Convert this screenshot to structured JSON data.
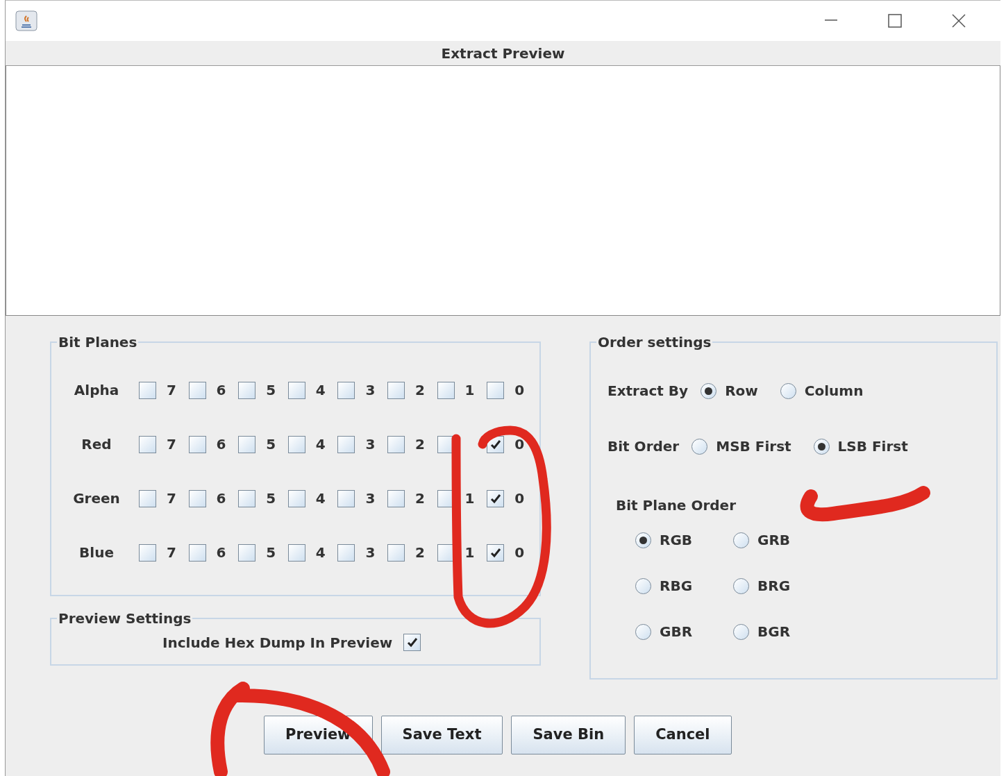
{
  "window": {
    "title": "Extract Preview"
  },
  "bit_planes": {
    "title": "Bit Planes",
    "rows": [
      {
        "label": "Alpha",
        "bits": [
          {
            "label": "7",
            "checked": false
          },
          {
            "label": "6",
            "checked": false
          },
          {
            "label": "5",
            "checked": false
          },
          {
            "label": "4",
            "checked": false
          },
          {
            "label": "3",
            "checked": false
          },
          {
            "label": "2",
            "checked": false
          },
          {
            "label": "1",
            "checked": false
          },
          {
            "label": "0",
            "checked": false
          }
        ]
      },
      {
        "label": "Red",
        "bits": [
          {
            "label": "7",
            "checked": false
          },
          {
            "label": "6",
            "checked": false
          },
          {
            "label": "5",
            "checked": false
          },
          {
            "label": "4",
            "checked": false
          },
          {
            "label": "3",
            "checked": false
          },
          {
            "label": "2",
            "checked": false
          },
          {
            "checked": false
          },
          {
            "label": "0",
            "checked": true
          }
        ]
      },
      {
        "label": "Green",
        "bits": [
          {
            "label": "7",
            "checked": false
          },
          {
            "label": "6",
            "checked": false
          },
          {
            "label": "5",
            "checked": false
          },
          {
            "label": "4",
            "checked": false
          },
          {
            "label": "3",
            "checked": false
          },
          {
            "label": "2",
            "checked": false
          },
          {
            "label": "1",
            "checked": false
          },
          {
            "label": "0",
            "checked": true
          }
        ]
      },
      {
        "label": "Blue",
        "bits": [
          {
            "label": "7",
            "checked": false
          },
          {
            "label": "6",
            "checked": false
          },
          {
            "label": "5",
            "checked": false
          },
          {
            "label": "4",
            "checked": false
          },
          {
            "label": "3",
            "checked": false
          },
          {
            "label": "2",
            "checked": false
          },
          {
            "label": "1",
            "checked": false
          },
          {
            "label": "0",
            "checked": true
          }
        ]
      }
    ]
  },
  "preview_settings": {
    "title": "Preview Settings",
    "hex_dump": {
      "label": "Include Hex Dump In Preview",
      "checked": true
    }
  },
  "order_settings": {
    "title": "Order settings",
    "extract_by": {
      "label": "Extract By",
      "options": [
        {
          "label": "Row",
          "selected": true
        },
        {
          "label": "Column",
          "selected": false
        }
      ]
    },
    "bit_order": {
      "label": "Bit Order",
      "options": [
        {
          "label": "MSB First",
          "selected": false
        },
        {
          "label": "LSB First",
          "selected": true
        }
      ]
    },
    "bit_plane_order": {
      "label": "Bit Plane Order",
      "options": [
        {
          "label": "RGB",
          "selected": true
        },
        {
          "label": "GRB",
          "selected": false
        },
        {
          "label": "RBG",
          "selected": false
        },
        {
          "label": "BRG",
          "selected": false
        },
        {
          "label": "GBR",
          "selected": false
        },
        {
          "label": "BGR",
          "selected": false
        }
      ]
    }
  },
  "buttons": [
    "Preview",
    "Save Text",
    "Save Bin",
    "Cancel"
  ]
}
